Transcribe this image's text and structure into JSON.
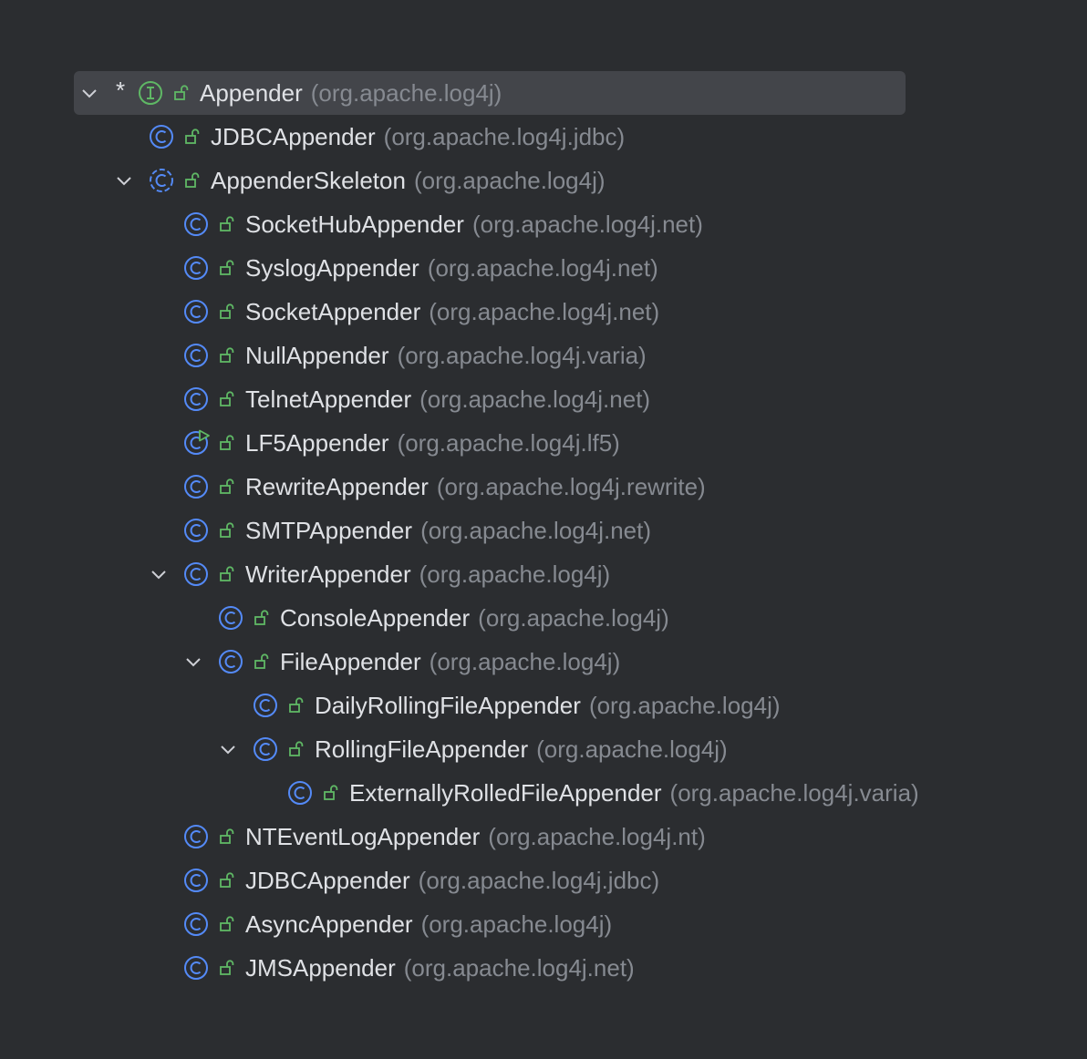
{
  "hierarchy": {
    "root": {
      "name": "Appender",
      "package": "(org.apache.log4j)",
      "kind": "interface",
      "marker": "*"
    },
    "rows": [
      {
        "name": "JDBCAppender",
        "package": "(org.apache.log4j.jdbc)"
      },
      {
        "name": "AppenderSkeleton",
        "package": "(org.apache.log4j)"
      },
      {
        "name": "SocketHubAppender",
        "package": "(org.apache.log4j.net)"
      },
      {
        "name": "SyslogAppender",
        "package": "(org.apache.log4j.net)"
      },
      {
        "name": "SocketAppender",
        "package": "(org.apache.log4j.net)"
      },
      {
        "name": "NullAppender",
        "package": "(org.apache.log4j.varia)"
      },
      {
        "name": "TelnetAppender",
        "package": "(org.apache.log4j.net)"
      },
      {
        "name": "LF5Appender",
        "package": "(org.apache.log4j.lf5)"
      },
      {
        "name": "RewriteAppender",
        "package": "(org.apache.log4j.rewrite)"
      },
      {
        "name": "SMTPAppender",
        "package": "(org.apache.log4j.net)"
      },
      {
        "name": "WriterAppender",
        "package": "(org.apache.log4j)"
      },
      {
        "name": "ConsoleAppender",
        "package": "(org.apache.log4j)"
      },
      {
        "name": "FileAppender",
        "package": "(org.apache.log4j)"
      },
      {
        "name": "DailyRollingFileAppender",
        "package": "(org.apache.log4j)"
      },
      {
        "name": "RollingFileAppender",
        "package": "(org.apache.log4j)"
      },
      {
        "name": "ExternallyRolledFileAppender",
        "package": "(org.apache.log4j.varia)"
      },
      {
        "name": "NTEventLogAppender",
        "package": "(org.apache.log4j.nt)"
      },
      {
        "name": "JDBCAppender",
        "package": "(org.apache.log4j.jdbc)"
      },
      {
        "name": "AsyncAppender",
        "package": "(org.apache.log4j)"
      },
      {
        "name": "JMSAppender",
        "package": "(org.apache.log4j.net)"
      }
    ]
  },
  "colors": {
    "background": "#2b2d30",
    "selection": "#43454a",
    "text": "#dfe1e5",
    "package_text": "#868a91",
    "class_icon": "#548af7",
    "interface_icon": "#5fb865",
    "lock_icon": "#5fb865"
  }
}
